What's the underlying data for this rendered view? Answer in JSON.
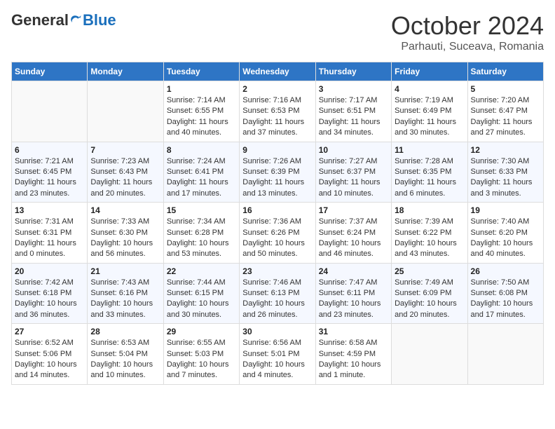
{
  "header": {
    "logo_general": "General",
    "logo_blue": "Blue",
    "month": "October 2024",
    "location": "Parhauti, Suceava, Romania"
  },
  "columns": [
    "Sunday",
    "Monday",
    "Tuesday",
    "Wednesday",
    "Thursday",
    "Friday",
    "Saturday"
  ],
  "rows": [
    [
      {
        "day": "",
        "info": ""
      },
      {
        "day": "",
        "info": ""
      },
      {
        "day": "1",
        "info": "Sunrise: 7:14 AM\nSunset: 6:55 PM\nDaylight: 11 hours and 40 minutes."
      },
      {
        "day": "2",
        "info": "Sunrise: 7:16 AM\nSunset: 6:53 PM\nDaylight: 11 hours and 37 minutes."
      },
      {
        "day": "3",
        "info": "Sunrise: 7:17 AM\nSunset: 6:51 PM\nDaylight: 11 hours and 34 minutes."
      },
      {
        "day": "4",
        "info": "Sunrise: 7:19 AM\nSunset: 6:49 PM\nDaylight: 11 hours and 30 minutes."
      },
      {
        "day": "5",
        "info": "Sunrise: 7:20 AM\nSunset: 6:47 PM\nDaylight: 11 hours and 27 minutes."
      }
    ],
    [
      {
        "day": "6",
        "info": "Sunrise: 7:21 AM\nSunset: 6:45 PM\nDaylight: 11 hours and 23 minutes."
      },
      {
        "day": "7",
        "info": "Sunrise: 7:23 AM\nSunset: 6:43 PM\nDaylight: 11 hours and 20 minutes."
      },
      {
        "day": "8",
        "info": "Sunrise: 7:24 AM\nSunset: 6:41 PM\nDaylight: 11 hours and 17 minutes."
      },
      {
        "day": "9",
        "info": "Sunrise: 7:26 AM\nSunset: 6:39 PM\nDaylight: 11 hours and 13 minutes."
      },
      {
        "day": "10",
        "info": "Sunrise: 7:27 AM\nSunset: 6:37 PM\nDaylight: 11 hours and 10 minutes."
      },
      {
        "day": "11",
        "info": "Sunrise: 7:28 AM\nSunset: 6:35 PM\nDaylight: 11 hours and 6 minutes."
      },
      {
        "day": "12",
        "info": "Sunrise: 7:30 AM\nSunset: 6:33 PM\nDaylight: 11 hours and 3 minutes."
      }
    ],
    [
      {
        "day": "13",
        "info": "Sunrise: 7:31 AM\nSunset: 6:31 PM\nDaylight: 11 hours and 0 minutes."
      },
      {
        "day": "14",
        "info": "Sunrise: 7:33 AM\nSunset: 6:30 PM\nDaylight: 10 hours and 56 minutes."
      },
      {
        "day": "15",
        "info": "Sunrise: 7:34 AM\nSunset: 6:28 PM\nDaylight: 10 hours and 53 minutes."
      },
      {
        "day": "16",
        "info": "Sunrise: 7:36 AM\nSunset: 6:26 PM\nDaylight: 10 hours and 50 minutes."
      },
      {
        "day": "17",
        "info": "Sunrise: 7:37 AM\nSunset: 6:24 PM\nDaylight: 10 hours and 46 minutes."
      },
      {
        "day": "18",
        "info": "Sunrise: 7:39 AM\nSunset: 6:22 PM\nDaylight: 10 hours and 43 minutes."
      },
      {
        "day": "19",
        "info": "Sunrise: 7:40 AM\nSunset: 6:20 PM\nDaylight: 10 hours and 40 minutes."
      }
    ],
    [
      {
        "day": "20",
        "info": "Sunrise: 7:42 AM\nSunset: 6:18 PM\nDaylight: 10 hours and 36 minutes."
      },
      {
        "day": "21",
        "info": "Sunrise: 7:43 AM\nSunset: 6:16 PM\nDaylight: 10 hours and 33 minutes."
      },
      {
        "day": "22",
        "info": "Sunrise: 7:44 AM\nSunset: 6:15 PM\nDaylight: 10 hours and 30 minutes."
      },
      {
        "day": "23",
        "info": "Sunrise: 7:46 AM\nSunset: 6:13 PM\nDaylight: 10 hours and 26 minutes."
      },
      {
        "day": "24",
        "info": "Sunrise: 7:47 AM\nSunset: 6:11 PM\nDaylight: 10 hours and 23 minutes."
      },
      {
        "day": "25",
        "info": "Sunrise: 7:49 AM\nSunset: 6:09 PM\nDaylight: 10 hours and 20 minutes."
      },
      {
        "day": "26",
        "info": "Sunrise: 7:50 AM\nSunset: 6:08 PM\nDaylight: 10 hours and 17 minutes."
      }
    ],
    [
      {
        "day": "27",
        "info": "Sunrise: 6:52 AM\nSunset: 5:06 PM\nDaylight: 10 hours and 14 minutes."
      },
      {
        "day": "28",
        "info": "Sunrise: 6:53 AM\nSunset: 5:04 PM\nDaylight: 10 hours and 10 minutes."
      },
      {
        "day": "29",
        "info": "Sunrise: 6:55 AM\nSunset: 5:03 PM\nDaylight: 10 hours and 7 minutes."
      },
      {
        "day": "30",
        "info": "Sunrise: 6:56 AM\nSunset: 5:01 PM\nDaylight: 10 hours and 4 minutes."
      },
      {
        "day": "31",
        "info": "Sunrise: 6:58 AM\nSunset: 4:59 PM\nDaylight: 10 hours and 1 minute."
      },
      {
        "day": "",
        "info": ""
      },
      {
        "day": "",
        "info": ""
      }
    ]
  ]
}
